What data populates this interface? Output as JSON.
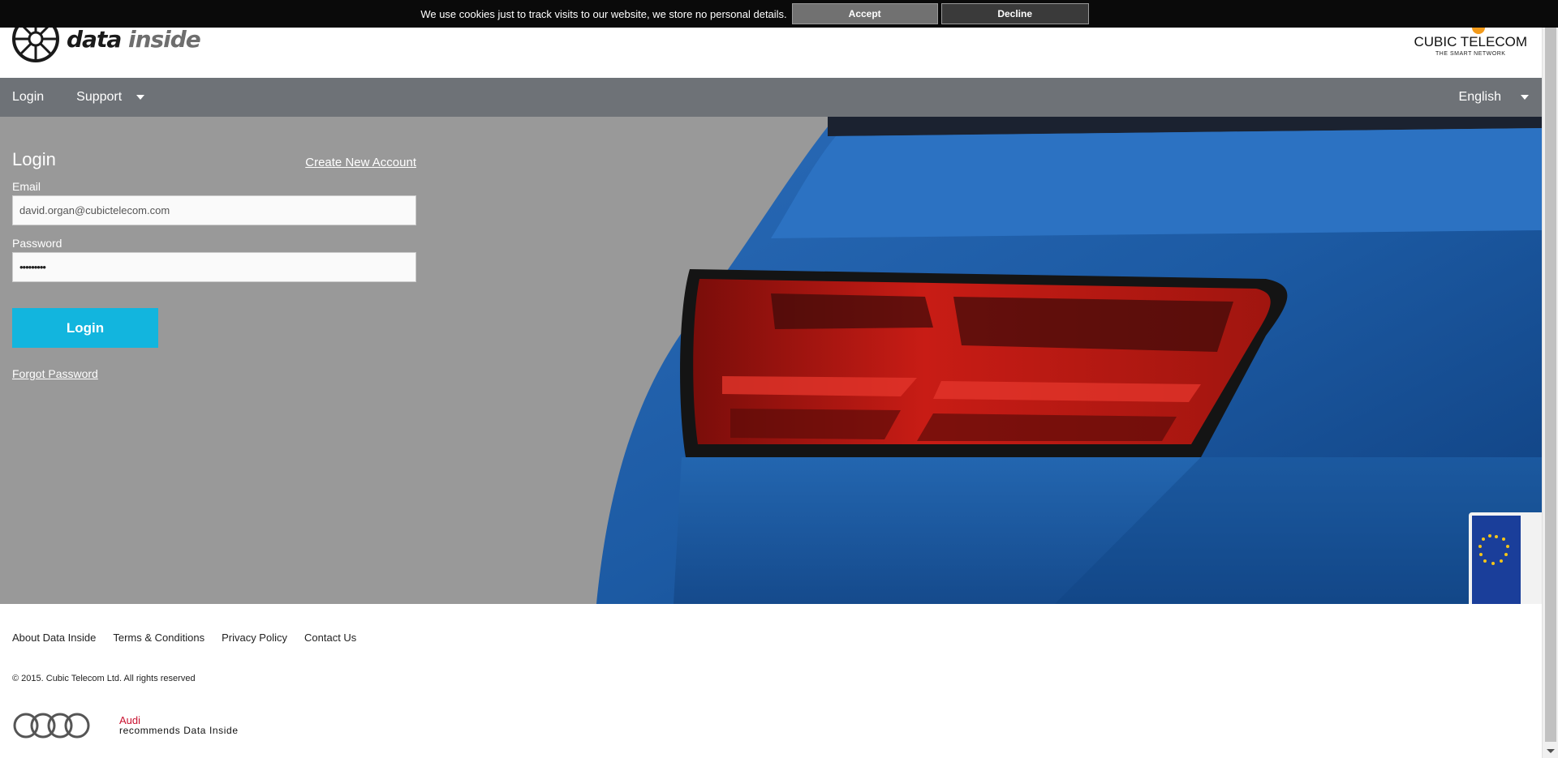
{
  "cookie_bar": {
    "text": "We use cookies just to track visits to our website, we store no personal details.",
    "accept_label": "Accept",
    "decline_label": "Decline"
  },
  "header": {
    "logo_text_bold": "data",
    "logo_text_light": "inside",
    "partner_name": "CUBIC TELECOM",
    "partner_tagline": "THE SMART NETWORK"
  },
  "nav": {
    "items": [
      {
        "label": "Login"
      },
      {
        "label": "Support"
      }
    ],
    "language": "English"
  },
  "login": {
    "title": "Login",
    "create_account_label": "Create New Account",
    "email_label": "Email",
    "email_value": "david.organ@cubictelecom.com",
    "password_label": "Password",
    "password_value": "•••••••••",
    "submit_label": "Login",
    "forgot_label": "Forgot Password"
  },
  "footer": {
    "links": [
      {
        "label": "About Data Inside"
      },
      {
        "label": "Terms & Conditions"
      },
      {
        "label": "Privacy Policy"
      },
      {
        "label": "Contact Us"
      }
    ],
    "copyright": "© 2015. Cubic Telecom Ltd. All rights reserved",
    "audi_brand": "Audi",
    "audi_recommends": "recommends Data Inside"
  },
  "colors": {
    "nav_bg": "#6e7277",
    "hero_bg": "#999999",
    "login_button": "#12b5de",
    "car_blue": "#1f5ca8",
    "taillight_red": "#c01a14",
    "audi_red": "#c8102e"
  },
  "icons": {
    "logo": "wheel-icon",
    "nav_caret": "caret-down-icon",
    "audi": "audi-rings-icon"
  }
}
